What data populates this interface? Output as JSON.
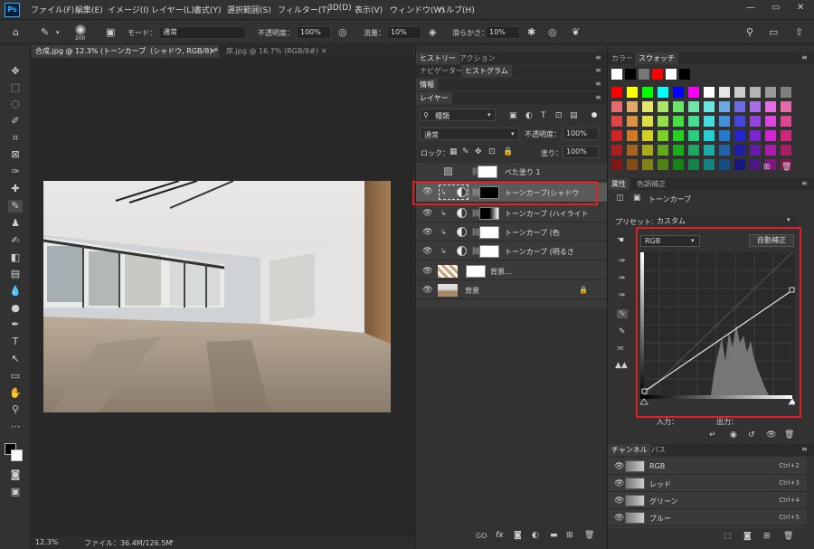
{
  "menu": {
    "logo": "Ps",
    "items": [
      "ファイル(F)",
      "編集(E)",
      "イメージ(I)",
      "レイヤー(L)",
      "書式(Y)",
      "選択範囲(S)",
      "フィルター(T)",
      "3D(D)",
      "表示(V)",
      "ウィンドウ(W)",
      "ヘルプ(H)"
    ]
  },
  "options": {
    "brush_size": "200",
    "mode_label": "モード：",
    "mode_value": "通常",
    "opacity_label": "不透明度：",
    "opacity_value": "100%",
    "flow_label": "流量：",
    "flow_value": "10%",
    "smooth_label": "滑らかさ：",
    "smooth_value": "10%"
  },
  "doc_tabs": [
    {
      "label": "合成.jpg @ 12.3% (トーンカーブ（シャドウ, RGB/8) *"
    },
    {
      "label": "床.jpg @ 16.7% (RGB/8#)"
    }
  ],
  "status": {
    "zoom": "12.3%",
    "file": "ファイル：36.4M/126.5M"
  },
  "mid_panel": {
    "tabs_top": [
      "ヒストリー",
      "アクション"
    ],
    "tabs_nav": [
      "ナビゲーター",
      "ヒストグラム"
    ],
    "info_tab": "情報",
    "layers_tab": "レイヤー",
    "filter_kind": "種類",
    "blend_mode": "通常",
    "opacity_label": "不透明度：",
    "opacity_value": "100%",
    "lock_label": "ロック：",
    "fill_label": "塗り：",
    "fill_value": "100%",
    "layers": [
      {
        "name": "べた塗り 1"
      },
      {
        "name": "トーンカーブ(シャドウ"
      },
      {
        "name": "トーンカーブ (ハイライト"
      },
      {
        "name": "トーンカーブ (色"
      },
      {
        "name": "トーンカーブ (明るさ"
      },
      {
        "name": "背景..."
      },
      {
        "name": "背景"
      }
    ],
    "bottom_icons": [
      "GO",
      "fx"
    ]
  },
  "right_panel": {
    "color_tabs": [
      "カラー",
      "スウォッチ"
    ],
    "props_tabs": [
      "属性",
      "色調補正"
    ],
    "props_title": "トーンカーブ",
    "preset_label": "プリセット：",
    "preset_value": "カスタム",
    "channel_value": "RGB",
    "auto_button": "自動補正",
    "input_label": "入力：",
    "output_label": "出力：",
    "channels_tabs": [
      "チャンネル",
      "パス"
    ],
    "channels": [
      {
        "name": "RGB",
        "key": "Ctrl+2"
      },
      {
        "name": "レッド",
        "key": "Ctrl+3"
      },
      {
        "name": "グリーン",
        "key": "Ctrl+4"
      },
      {
        "name": "ブルー",
        "key": "Ctrl+5"
      }
    ]
  }
}
